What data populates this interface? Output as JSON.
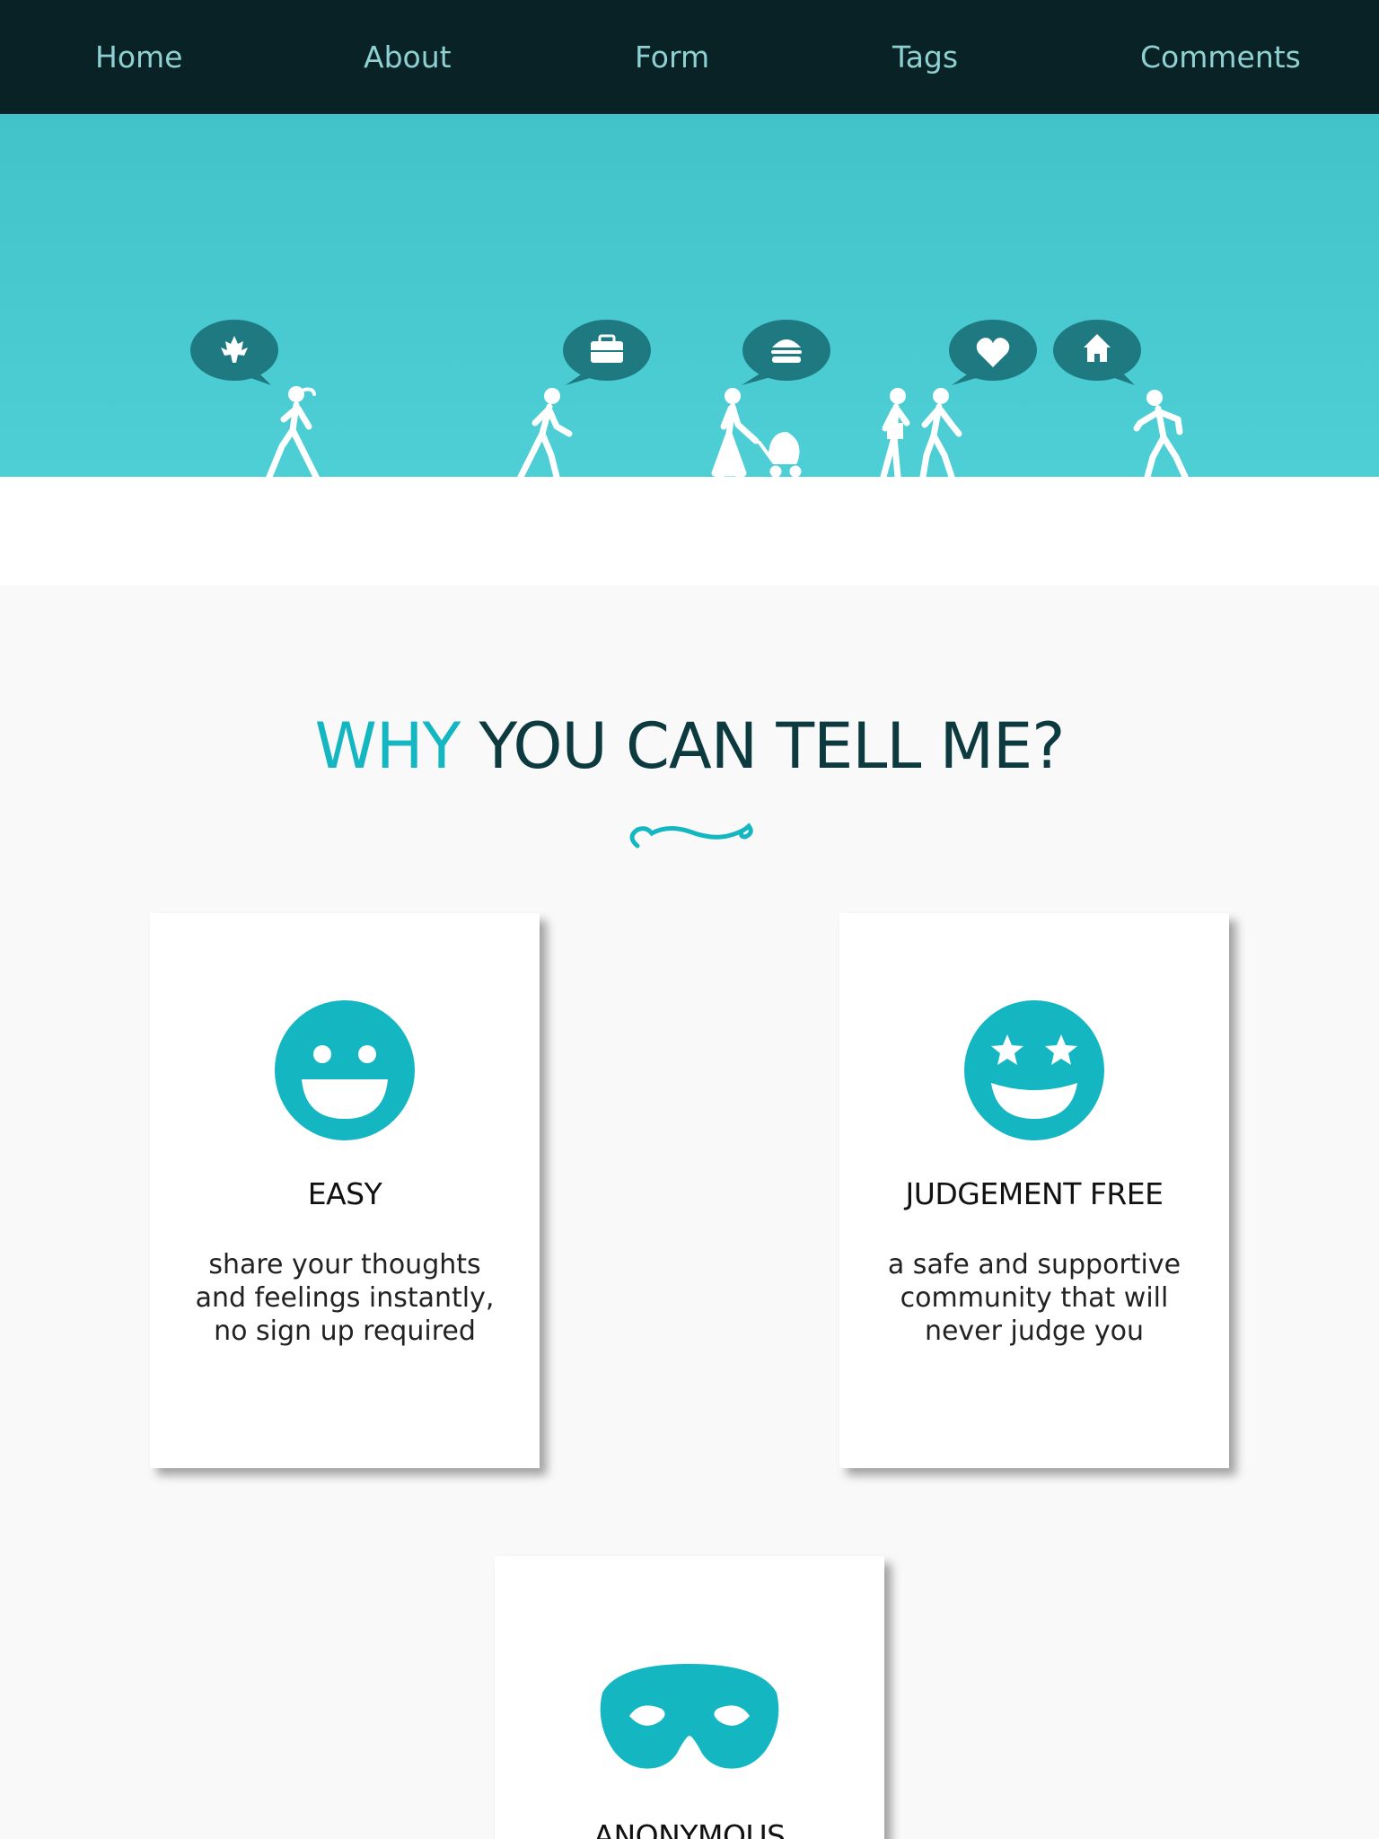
{
  "nav": {
    "items": [
      "Home",
      "About",
      "Form",
      "Tags",
      "Comments"
    ]
  },
  "hero": {
    "bubble_icons": [
      "maple-leaf-icon",
      "briefcase-icon",
      "burger-icon",
      "heart-icon",
      "house-icon"
    ]
  },
  "section": {
    "title_accent": "WHY",
    "title_rest": "YOU CAN TELL ME?"
  },
  "cards": [
    {
      "icon": "smile-face-icon",
      "title": "EASY",
      "desc": "share your thoughts and feelings instantly, no sign up required"
    },
    {
      "icon": "star-eyes-face-icon",
      "title": "JUDGEMENT FREE",
      "desc": "a safe and supportive community that will never judge you"
    },
    {
      "icon": "mask-icon",
      "title": "ANONYMOUS"
    }
  ],
  "colors": {
    "nav_bg": "#082226",
    "nav_text": "#8fd0d2",
    "hero_bg": "#4acbd1",
    "bubble": "#1e7a80",
    "accent": "#14b6c2",
    "title_dark": "#0c3a3f"
  }
}
